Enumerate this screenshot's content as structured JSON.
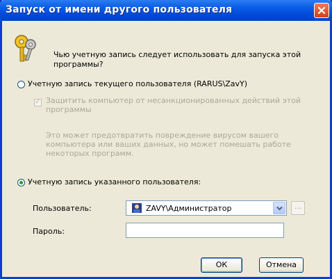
{
  "window": {
    "title": "Запуск от имени другого пользователя",
    "title_bar_color": "#0a5ee8",
    "close_color": "#d1411c"
  },
  "question": "Чью учетную запись следует использовать для запуска этой программы?",
  "options": {
    "current_user": {
      "label": "Учетную запись текущего пользователя (RARUS\\ZavY)",
      "selected": false,
      "protect_checkbox": {
        "label": "Защитить компьютер от несанкционированных действий этой программы",
        "checked": true,
        "enabled": false
      },
      "note": "Это может предотвратить повреждение вирусом вашего компьютера или ваших данных, но может помешать работе некоторых программ."
    },
    "specified_user": {
      "label": "Учетную запись указанного пользователя:",
      "selected": true
    }
  },
  "fields": {
    "user_label": "Пользователь:",
    "user_value": "ZAVY\\Администратор",
    "user_icon": "user-account-icon",
    "browse_label": "...",
    "password_label": "Пароль:",
    "password_value": ""
  },
  "buttons": {
    "ok": "ОК",
    "cancel": "Отмена"
  }
}
